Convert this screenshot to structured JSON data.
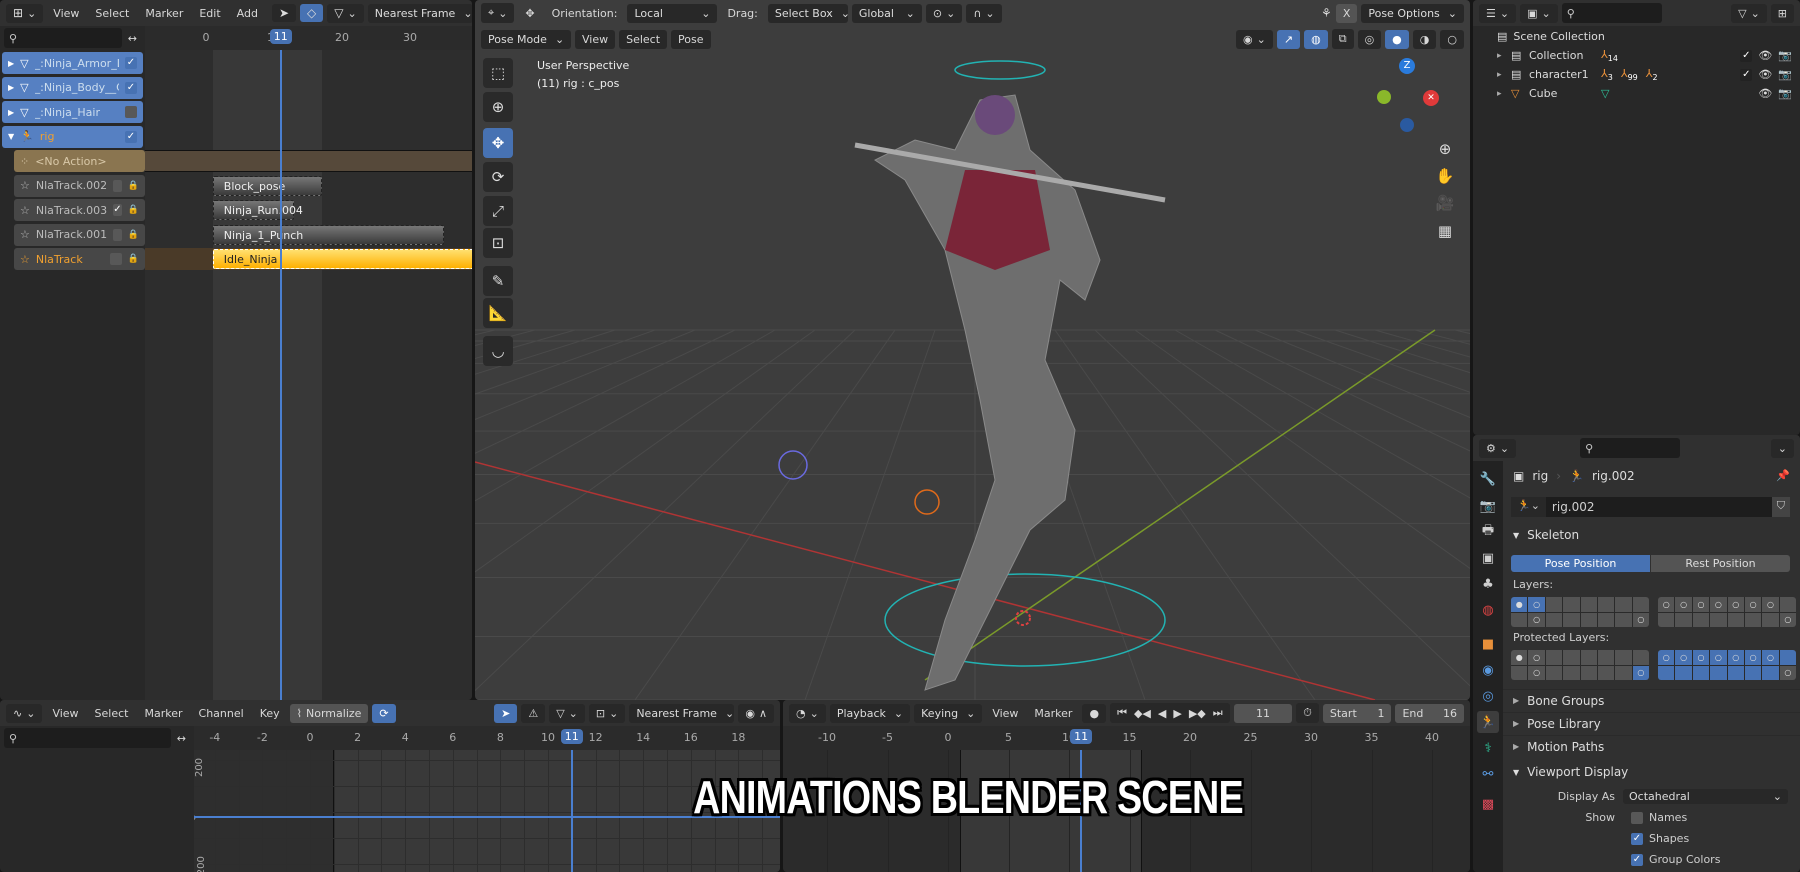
{
  "nla": {
    "menu": [
      "View",
      "Select",
      "Marker",
      "Edit",
      "Add"
    ],
    "snap": "Nearest Frame",
    "ruler": [
      "0",
      "10",
      "20",
      "30"
    ],
    "current_frame": "11",
    "channels": [
      {
        "name": "_:Ninja_Armor_Legs",
        "type": "object",
        "checked": true
      },
      {
        "name": "_:Ninja_Body__Cloth",
        "type": "object",
        "checked": true
      },
      {
        "name": "_:Ninja_Hair",
        "type": "object",
        "checked": false
      },
      {
        "name": "rig",
        "type": "armature",
        "checked": true
      }
    ],
    "action_line": "<No Action>",
    "tracks": [
      {
        "name": "NlaTrack.002",
        "checked": false,
        "strip": "Block_pose",
        "end": 17
      },
      {
        "name": "NlaTrack.003",
        "checked": true,
        "strip": "Ninja_Run.004",
        "end": 13
      },
      {
        "name": "NlaTrack.001",
        "checked": false,
        "strip": "Ninja_1_Punch",
        "end": 35
      },
      {
        "name": "NlaTrack",
        "checked": false,
        "strip": "Idle_Ninja",
        "end": 40,
        "active": true
      }
    ]
  },
  "viewport": {
    "orientation_label": "Orientation:",
    "orientation": "Local",
    "drag_label": "Drag:",
    "drag": "Select Box",
    "transform": "Global",
    "mirror_x": "X",
    "pose_options": "Pose Options",
    "mode": "Pose Mode",
    "menu": [
      "View",
      "Select",
      "Pose"
    ],
    "info_line1": "User Perspective",
    "info_line2": "(11) rig : c_pos",
    "gizmo_z": "Z"
  },
  "outliner": {
    "root": "Scene Collection",
    "items": [
      {
        "name": "Collection",
        "badges": [
          "14"
        ],
        "checked": true
      },
      {
        "name": "character1",
        "badges": [
          "3",
          "99",
          "2"
        ],
        "checked": true
      },
      {
        "name": "Cube",
        "badges": [],
        "checked": null
      }
    ]
  },
  "properties": {
    "object": "rig",
    "data": "rig.002",
    "datablock": "rig.002",
    "skeleton": "Skeleton",
    "pose_position": "Pose Position",
    "rest_position": "Rest Position",
    "pose_position_active": true,
    "layers_label": "Layers:",
    "protected_label": "Protected Layers:",
    "layers": {
      "a": [
        "s*",
        "so",
        "",
        "",
        "",
        "",
        "",
        "",
        "",
        "o",
        "",
        "",
        "",
        "",
        "",
        "o"
      ],
      "b": [
        "o",
        "o",
        "o",
        "o",
        "o",
        "o",
        "o",
        "",
        "",
        "",
        "",
        "",
        "",
        "",
        "",
        "o"
      ]
    },
    "protected": {
      "a": [
        "*",
        "o",
        "",
        "",
        "",
        "",
        "",
        "",
        "",
        "o",
        "",
        "",
        "",
        "",
        "",
        "so"
      ],
      "b": [
        "so",
        "so",
        "so",
        "so",
        "so",
        "so",
        "so",
        "s",
        "s",
        "s",
        "s",
        "s",
        "s",
        "s",
        "s",
        "o"
      ]
    },
    "panels": [
      "Bone Groups",
      "Pose Library",
      "Motion Paths"
    ],
    "viewport_display": "Viewport Display",
    "display_as_label": "Display As",
    "display_as": "Octahedral",
    "show_label": "Show",
    "show": [
      {
        "label": "Names",
        "checked": false
      },
      {
        "label": "Shapes",
        "checked": true
      },
      {
        "label": "Group Colors",
        "checked": true
      }
    ]
  },
  "graph": {
    "menu": [
      "View",
      "Select",
      "Marker",
      "Channel",
      "Key"
    ],
    "normalize": "Normalize",
    "snap": "Nearest Frame",
    "ruler": [
      "-4",
      "-2",
      "0",
      "2",
      "4",
      "6",
      "8",
      "10",
      "12",
      "14",
      "16",
      "18"
    ],
    "current_frame": "11",
    "y_ticks": [
      "200",
      "0",
      "-200"
    ]
  },
  "timeline": {
    "menu": [
      "Playback",
      "Keying",
      "View",
      "Marker"
    ],
    "frame": "11",
    "start_label": "Start",
    "start": "1",
    "end_label": "End",
    "end": "16",
    "ruler": [
      "-10",
      "-5",
      "0",
      "5",
      "10",
      "15",
      "20",
      "25",
      "30",
      "35",
      "40"
    ],
    "current_frame": "11"
  },
  "overlay_title": "ANIMATIONS BLENDER SCENE",
  "colors": {
    "accent": "#4772b3",
    "active_strip": "#ffc21a",
    "playhead": "#4a7fd0",
    "x_axis": "#c23a3a",
    "y_axis": "#7a9a2a",
    "rig": "#22b3b3"
  }
}
